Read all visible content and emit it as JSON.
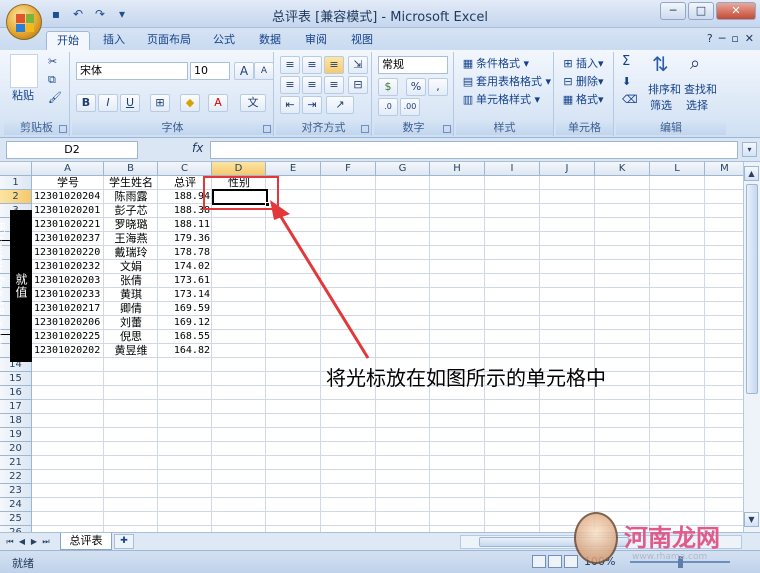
{
  "window": {
    "title": "总评表 [兼容模式] - Microsoft Excel",
    "controls": [
      "─",
      "□",
      "✕"
    ]
  },
  "ribbon_tabs": [
    "开始",
    "插入",
    "页面布局",
    "公式",
    "数据",
    "审阅",
    "视图"
  ],
  "ribbon_tab_active": "开始",
  "ribbon": {
    "clipboard": {
      "label": "剪贴板",
      "paste": "粘贴"
    },
    "font": {
      "label": "字体",
      "font_name": "宋体",
      "font_size": "10",
      "bold": "B",
      "italic": "I",
      "underline": "U",
      "grow": "A",
      "shrink": "A",
      "phonetic": "文"
    },
    "alignment": {
      "label": "对齐方式"
    },
    "number": {
      "label": "数字",
      "format": "常规",
      "percent": "%",
      "comma": ","
    },
    "styles": {
      "label": "样式",
      "conditional": "条件格式",
      "table": "套用表格格式",
      "cell_styles": "单元格样式"
    },
    "cells": {
      "label": "单元格",
      "insert": "插入",
      "delete": "删除",
      "format": "格式"
    },
    "editing": {
      "label": "编辑",
      "sort": "排序和",
      "sort2": "筛选",
      "find": "查找和",
      "find2": "选择",
      "sigma": "Σ"
    }
  },
  "formula_bar": {
    "name_box": "D2",
    "fx": "fx",
    "content": ""
  },
  "columns": [
    "A",
    "B",
    "C",
    "D",
    "E",
    "F",
    "G",
    "H",
    "I",
    "J",
    "K",
    "L",
    "M"
  ],
  "rows": [
    "1",
    "2",
    "3",
    "4",
    "5",
    "6",
    "7",
    "8",
    "9",
    "10",
    "11",
    "12",
    "13",
    "14",
    "15",
    "16",
    "17",
    "18",
    "19",
    "20",
    "21",
    "22",
    "23",
    "24",
    "25",
    "26"
  ],
  "header_row": {
    "a": "学号",
    "b": "学生姓名",
    "c": "总评",
    "d": "性别"
  },
  "data_rows": [
    {
      "id": "12301020204",
      "name": "陈雨露",
      "score": "188.94"
    },
    {
      "id": "12301020201",
      "name": "彭子芯",
      "score": "188.38"
    },
    {
      "id": "12301020221",
      "name": "罗晓璐",
      "score": "188.11"
    },
    {
      "id": "12301020237",
      "name": "王海燕",
      "score": "179.36"
    },
    {
      "id": "12301020220",
      "name": "戴瑞玲",
      "score": "178.78"
    },
    {
      "id": "12301020232",
      "name": "文娟",
      "score": "174.02"
    },
    {
      "id": "12301020203",
      "name": "张倩",
      "score": "173.61"
    },
    {
      "id": "12301020233",
      "name": "黄琪",
      "score": "173.14"
    },
    {
      "id": "12301020217",
      "name": "卿倩",
      "score": "169.59"
    },
    {
      "id": "12301020206",
      "name": "刘蕾",
      "score": "169.12"
    },
    {
      "id": "12301020225",
      "name": "倪思",
      "score": "168.55"
    },
    {
      "id": "12301020202",
      "name": "黄昱维",
      "score": "164.82"
    }
  ],
  "selected_cell": "D2",
  "vertical_watermark": "就值吧/www.fun48.com",
  "annotation": "将光标放在如图所示的单元格中",
  "sheet_tab": "总评表",
  "status": "就绪",
  "zoom": "100%",
  "site_brand": "河南龙网",
  "site_url": "www.rhama.com",
  "colors": {
    "accent": "#e2383b",
    "ribbon": "#dbe7f6",
    "selected_header": "#f6c86d"
  }
}
